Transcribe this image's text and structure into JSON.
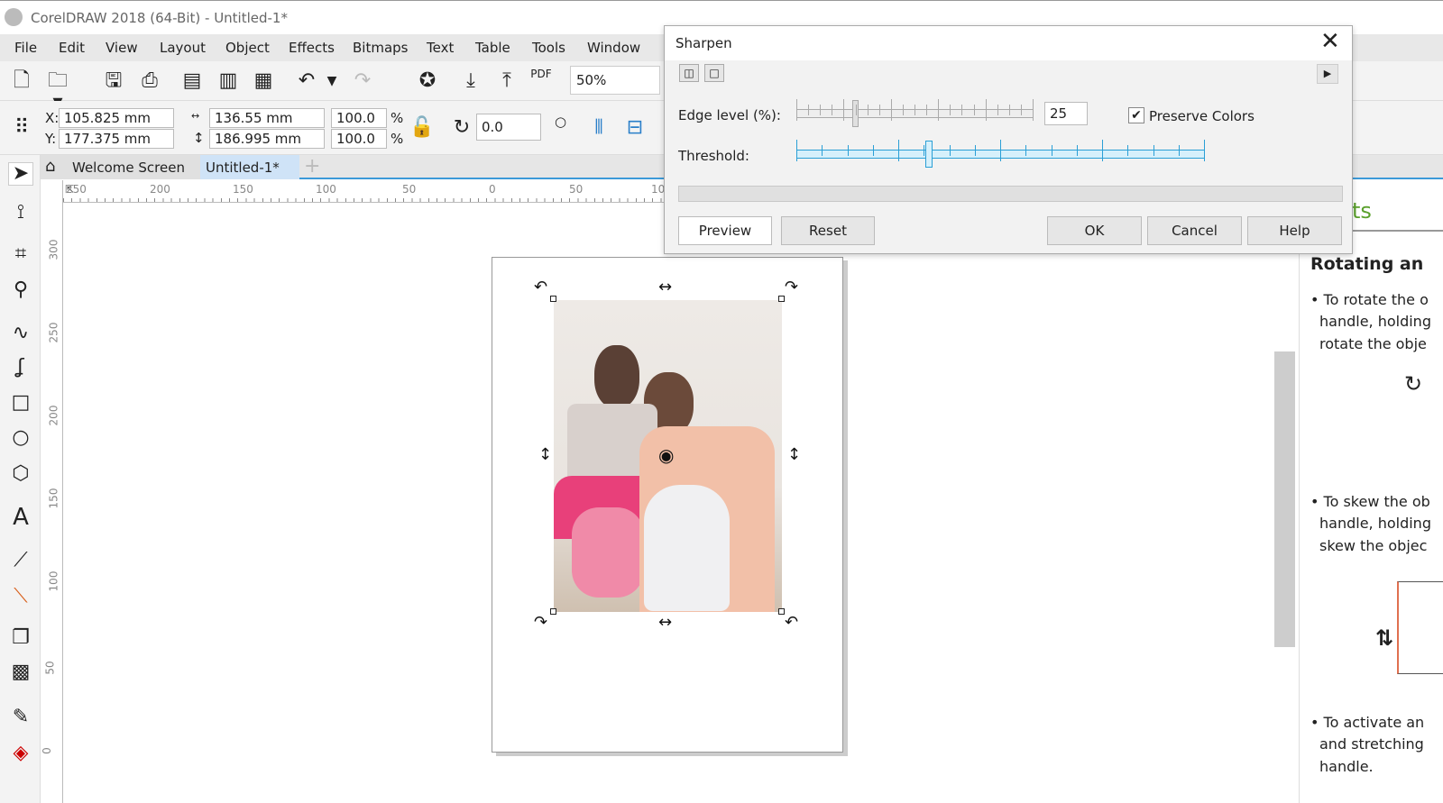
{
  "app": {
    "title": "CorelDRAW 2018 (64-Bit) - Untitled-1*"
  },
  "menu": [
    "File",
    "Edit",
    "View",
    "Layout",
    "Object",
    "Effects",
    "Bitmaps",
    "Text",
    "Table",
    "Tools",
    "Window"
  ],
  "toolbar": {
    "zoom": "50%",
    "pdf_label": "PDF"
  },
  "propbar": {
    "x_label": "X:",
    "x": "105.825 mm",
    "y_label": "Y:",
    "y": "177.375 mm",
    "width": "136.55 mm",
    "height": "186.995 mm",
    "scale_w": "100.0",
    "scale_h": "100.0",
    "pct": "%",
    "angle": "0.0"
  },
  "tabs": [
    {
      "label": "Welcome Screen"
    },
    {
      "label": "Untitled-1*"
    }
  ],
  "hruler": [
    "250",
    "200",
    "150",
    "100",
    "50",
    "0",
    "50",
    "10"
  ],
  "vruler": [
    "300",
    "250",
    "200",
    "150",
    "100",
    "50",
    "0"
  ],
  "dialog": {
    "title": "Sharpen",
    "edge_label": "Edge level (%):",
    "edge_value": "25",
    "edge_percent": 25,
    "preserve_label": "Preserve Colors",
    "preserve_checked": true,
    "threshold_label": "Threshold:",
    "threshold_level": 0.3,
    "buttons": {
      "preview": "Preview",
      "reset": "Reset",
      "ok": "OK",
      "cancel": "Cancel",
      "help": "Help"
    }
  },
  "docker": {
    "tab_fragment": "ts",
    "heading": "Rotating an",
    "lines": [
      "• To rotate the o",
      "handle, holding",
      "rotate the obje",
      "• To skew the ob",
      "handle, holding",
      "skew the objec",
      "• To activate an",
      "and stretching",
      "handle."
    ]
  },
  "colors": {
    "accent": "#3c9ad8",
    "threshold": "#2a9fd6",
    "docker_green": "#5aa02c"
  }
}
